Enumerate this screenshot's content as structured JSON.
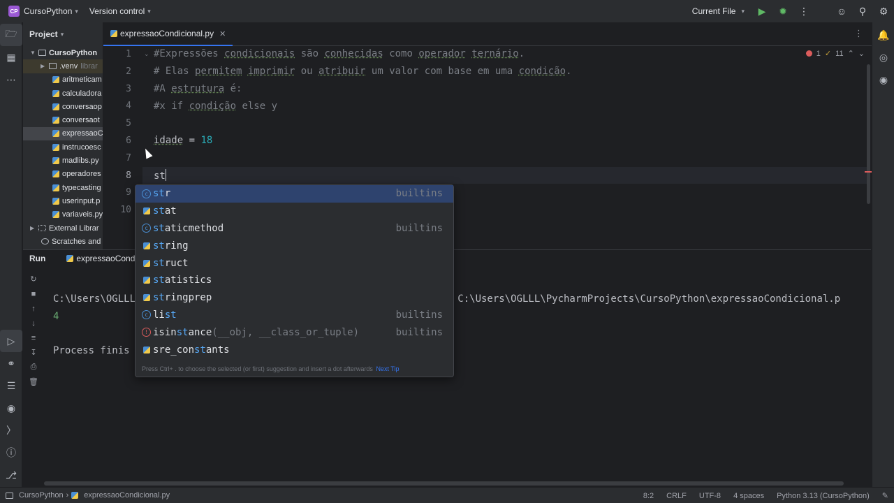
{
  "titlebar": {
    "project_badge": "CP",
    "project_name": "CursoPython",
    "vcs_label": "Version control",
    "run_config": "Current File"
  },
  "project_panel": {
    "title": "Project",
    "root": "CursoPython",
    "venv": ".venv",
    "venv_hint": "librar",
    "files": [
      "aritmeticam",
      "calculadora",
      "conversaop",
      "conversaot",
      "expressaoC",
      "instrucoesc",
      "madlibs.py",
      "operadores",
      "typecasting",
      "userinput.p",
      "variaveis.py"
    ],
    "external": "External Librar",
    "scratches": "Scratches and"
  },
  "editor": {
    "tab_label": "expressaoCondicional.py",
    "inspections": {
      "errors": "1",
      "warnings": "11"
    },
    "line_numbers": [
      "1",
      "2",
      "3",
      "4",
      "5",
      "6",
      "7",
      "8",
      "9",
      "10"
    ],
    "lines": {
      "l1": "#Expressões condicionais são conhecidas como operador ternário.",
      "l2": "# Elas permitem imprimir ou atribuir um valor com base em uma condição.",
      "l3": "#A estrutura é:",
      "l4": "#x if condição else y",
      "l6_var": "idade",
      "l6_op": " = ",
      "l6_num": "18",
      "l8": "st"
    }
  },
  "completion": {
    "items": [
      {
        "match": "st",
        "rest": "r",
        "sig": "",
        "type": "builtins",
        "icon": "class"
      },
      {
        "match": "st",
        "rest": "at",
        "sig": "",
        "type": "",
        "icon": "python"
      },
      {
        "match": "st",
        "rest": "aticmethod",
        "sig": "",
        "type": "builtins",
        "icon": "class"
      },
      {
        "match": "st",
        "rest": "ring",
        "sig": "",
        "type": "",
        "icon": "python"
      },
      {
        "match": "st",
        "rest": "ruct",
        "sig": "",
        "type": "",
        "icon": "python"
      },
      {
        "match": "st",
        "rest": "atistics",
        "sig": "",
        "type": "",
        "icon": "python"
      },
      {
        "match": "st",
        "rest": "ringprep",
        "sig": "",
        "type": "",
        "icon": "python"
      },
      {
        "pre": "li",
        "match": "st",
        "rest": "",
        "sig": "",
        "type": "builtins",
        "icon": "class"
      },
      {
        "pre": "isin",
        "match": "st",
        "rest": "ance",
        "sig": "(__obj, __class_or_tuple)",
        "type": "builtins",
        "icon": "error"
      },
      {
        "pre": "sre_con",
        "match": "st",
        "rest": "ants",
        "sig": "",
        "type": "",
        "icon": "python"
      }
    ],
    "footer": "Press Ctrl+ . to choose the selected (or first) suggestion and insert a dot afterwards",
    "next_tip": "Next Tip"
  },
  "run_panel": {
    "title": "Run",
    "tab_label": "expressaoCondicio",
    "console_line1_a": "C:\\Users\\OGLLL",
    "console_line1_b": "xe C:\\Users\\OGLLL\\PycharmProjects\\CursoPython\\expressaoCondicional.p",
    "console_line2": "4",
    "console_line4": "Process finis"
  },
  "statusbar": {
    "project": "CursoPython",
    "file": "expressaoCondicional.py",
    "position": "8:2",
    "line_sep": "CRLF",
    "encoding": "UTF-8",
    "indent": "4 spaces",
    "interpreter": "Python 3.13 (CursoPython)"
  }
}
